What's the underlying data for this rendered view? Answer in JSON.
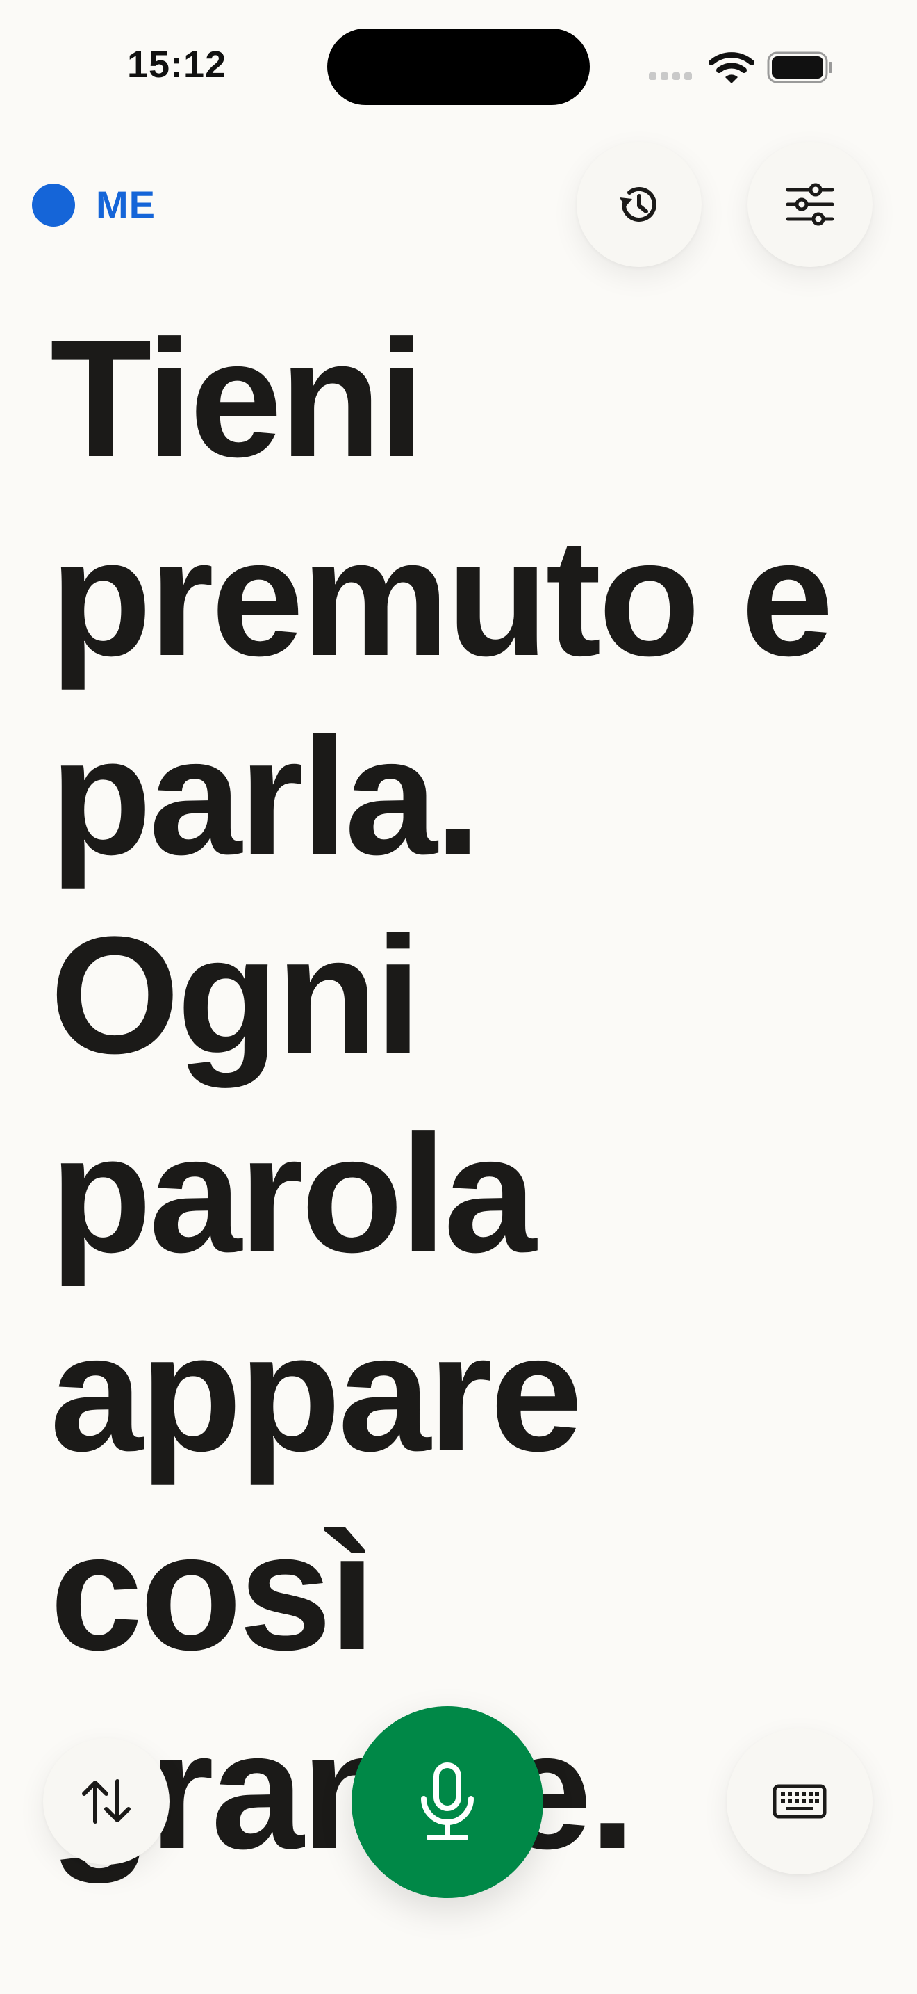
{
  "status_bar": {
    "time": "15:12"
  },
  "speaker": {
    "label": "ME",
    "color": "#1565d8"
  },
  "transcript": {
    "text": "Tieni premuto e parla. Ogni parola appare così grande."
  },
  "icons": {
    "history": "history-clock-icon",
    "settings": "sliders-icon",
    "swap": "swap-arrows-icon",
    "microphone": "microphone-icon",
    "keyboard": "keyboard-icon"
  },
  "colors": {
    "background": "#fbfaf7",
    "text": "#1b1a18",
    "accent_blue": "#1565d8",
    "mic_green": "#008847"
  }
}
